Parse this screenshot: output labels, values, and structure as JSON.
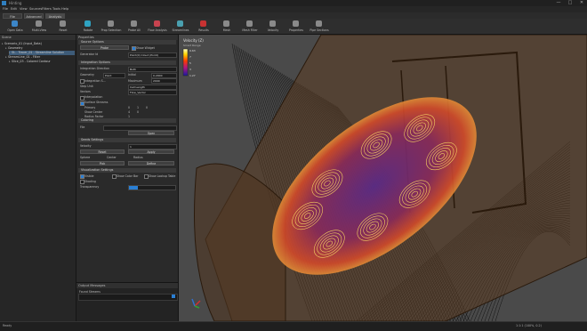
{
  "app": {
    "title": "Hinting",
    "window_controls": [
      "—",
      "□",
      "✕"
    ]
  },
  "menu": [
    "File",
    "Edit",
    "View",
    "Sources",
    "Filters",
    "Tools",
    "Help"
  ],
  "tabs": [
    "File",
    "Advanced",
    "Analysis"
  ],
  "ribbon": [
    {
      "label": "Open Data",
      "icon": "open-data-icon",
      "color": "#3c86c8"
    },
    {
      "label": "Multi-View",
      "icon": "multi-view-icon",
      "color": "#8a8a8a"
    },
    {
      "label": "Reset",
      "icon": "reset-icon",
      "color": "#8a8a8a"
    },
    {
      "label": "Rotate",
      "icon": "rotate-icon",
      "color": "#2fa3c2"
    },
    {
      "label": "Prop Selection",
      "icon": "selection-icon",
      "color": "#8a8a8a"
    },
    {
      "label": "Probe All",
      "icon": "probe-icon",
      "color": "#8a8a8a"
    },
    {
      "label": "Flow Analysis",
      "icon": "flow-analysis-icon",
      "color": "#c8434f"
    },
    {
      "label": "Streamlines",
      "icon": "streamlines-icon",
      "color": "#4aa0b0"
    },
    {
      "label": "Results",
      "icon": "results-icon",
      "color": "#c83232"
    },
    {
      "label": "Mesh",
      "icon": "mesh-icon",
      "color": "#8a8a8a"
    },
    {
      "label": "Mesh Filter",
      "icon": "mesh-filter-icon",
      "color": "#8a8a8a"
    },
    {
      "label": "Velocity",
      "icon": "velocity-icon",
      "color": "#8a8a8a"
    },
    {
      "label": "Properties",
      "icon": "properties-icon",
      "color": "#8a8a8a"
    },
    {
      "label": "Pipe Sections",
      "icon": "pipe-sections-icon",
      "color": "#8a8a8a"
    }
  ],
  "tree": {
    "title": "Scene",
    "items": [
      {
        "label": "Scenario_01 (Input_Data)",
        "level": 0,
        "selected": false
      },
      {
        "label": "Geometry",
        "level": 1,
        "selected": false
      },
      {
        "label": "St... Tracer_01 - Streamline Solution",
        "level": 2,
        "selected": true
      },
      {
        "label": "StreamLine_01 - Filter",
        "level": 1,
        "selected": false
      },
      {
        "label": "Slice_03 - Colored Contour",
        "level": 2,
        "selected": false
      }
    ]
  },
  "props": {
    "title": "Properties",
    "sections": {
      "source": "Source Options",
      "integration": "Integration Options",
      "coloring": "Coloring",
      "seeds": "Seeds Settings",
      "display": "Visualization Settings"
    },
    "source": {
      "button": "Probe",
      "check_label": "Show Widget",
      "generator_label": "Generator Id",
      "generator_value": "Point(0) Cloud (Point)"
    },
    "integration": {
      "direction_label": "Integration Direction",
      "direction_value": "Both",
      "geometry_label": "Geometry",
      "geometry_value": "Point",
      "initial_label": "Initial",
      "initial_value": "0.2000",
      "checkbox_label": "Integration S...",
      "step_label": "Step Unit",
      "step_value": "Cell Length",
      "max_label": "Maximum",
      "max_value": "2000",
      "vector_label": "Vectors",
      "vector_value": "Flow_Vector",
      "interp_label": "Interpolation",
      "surface_label": "Surface Streams",
      "options": [
        "Primary",
        "Show Center",
        "Radius Factor",
        "Show Points"
      ],
      "grid": [
        "0",
        "1",
        "0",
        "4",
        "0",
        "1"
      ]
    },
    "coloring": {
      "label": "File",
      "button": "Open"
    },
    "seeds": {
      "label": "Velocity",
      "value": "1",
      "btn_left": "Reset",
      "btn_right": "Apply",
      "params_label": "Sphere",
      "p1": "Center",
      "p2": "Radius",
      "btn_left2": "Pick",
      "btn_right2": "Define"
    },
    "display": {
      "visible_label": "Visible",
      "color_label": "Show Color Bar",
      "color_check_label": "Show Lookup Table",
      "shading_label": "Shading",
      "opacity_label": "Transparency",
      "opacity_value": 0.2
    },
    "bottom_panel": {
      "title": "Output Messages",
      "text": "Found Streams"
    }
  },
  "legend": {
    "title": "Velocity (Z)",
    "subtitle": "Smart Range",
    "ticks": [
      "9.63",
      "7",
      "5",
      "3",
      "1.27"
    ]
  },
  "colors": {
    "accent": "#2a7fd4",
    "selection": "#3d5b78",
    "viewport_bg": "#4a4a4a",
    "pipe": "#5b3d22"
  },
  "status": {
    "left": "Ready",
    "right": "1:1:1  (100%, 0.2)"
  }
}
